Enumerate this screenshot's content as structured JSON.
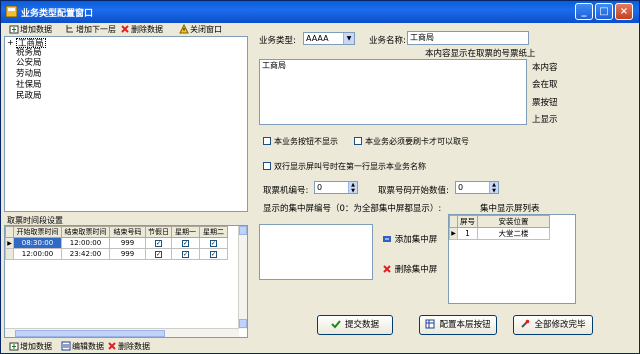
{
  "window": {
    "title": "业务类型配置窗口",
    "controls": [
      "_",
      "□",
      "×"
    ]
  },
  "left_toolbar": {
    "add_data": "增加数据",
    "add_next_level": "增加下一层",
    "delete_data": "删除数据",
    "close_window": "关闭窗口"
  },
  "tree": {
    "expander": "+",
    "items": [
      "工商局",
      "税务局",
      "公安局",
      "劳动局",
      "社保局",
      "民政局"
    ]
  },
  "time_grid": {
    "label": "取票时间段设置",
    "columns": [
      "开始取票时间",
      "结束取票时间",
      "结束号码",
      "节假日",
      "星期一",
      "星期二"
    ],
    "rows": [
      {
        "start": "08:30:00",
        "end": "12:00:00",
        "end_no": "999",
        "holiday": true,
        "mon": true,
        "tue": true
      },
      {
        "start": "12:00:00",
        "end": "23:42:00",
        "end_no": "999",
        "holiday": true,
        "mon": true,
        "tue": true
      }
    ]
  },
  "left_bottom_toolbar": {
    "add_data": "增加数据",
    "edit_data": "编辑数据",
    "delete_data": "删除数据"
  },
  "form": {
    "business_type_label": "业务类型:",
    "business_type_value": "AAAA",
    "business_name_label": "业务名称:",
    "business_name_value": "工商局",
    "ticket_hint": "本内容显示在取票的号票纸上",
    "ticket_content": "工商局",
    "side_note": [
      "本内容",
      "会在取",
      "票按钮",
      "上显示"
    ],
    "chk_hide_button": "本业务按钮不显示",
    "chk_swipe_card": "本业务必须要刷卡才可以取号",
    "chk_double_line": "双行显示屏叫号时在第一行显示本业务名称",
    "machine_no_label": "取票机编号:",
    "machine_no_value": "0",
    "start_no_label": "取票号码开始数值:",
    "start_no_value": "0",
    "screen_no_label": "显示的集中屏编号（0：为全部集中屏都显示）:",
    "screen_list_label": "集中显示屏列表",
    "add_screen": "添加集中屏",
    "delete_screen": "删除集中屏",
    "screen_table": {
      "columns": [
        "屏号",
        "安装位置"
      ],
      "rows": [
        {
          "no": "1",
          "location": "大堂二楼"
        }
      ]
    },
    "submit": "提交数据",
    "config_buttons": "配置本层按钮",
    "modify_all": "全部修改完毕"
  },
  "colors": {
    "title_bar": "#1c6cec",
    "selection": "#316ac5",
    "red_delete": "#e02020"
  }
}
